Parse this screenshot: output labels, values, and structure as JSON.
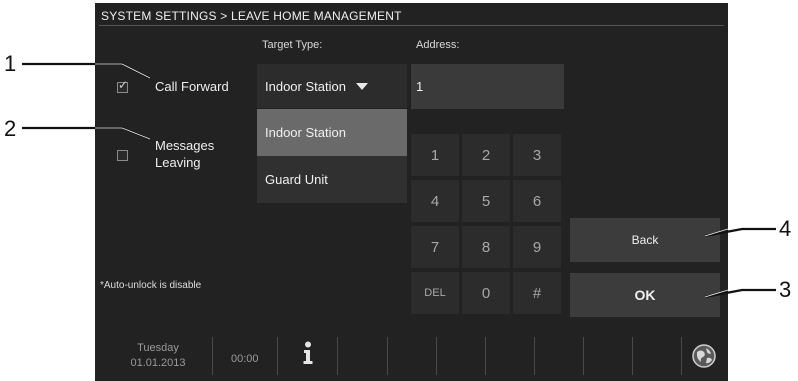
{
  "callouts": [
    "1",
    "2",
    "3",
    "4"
  ],
  "header": {
    "title": "SYSTEM SETTINGS > LEAVE HOME MANAGEMENT"
  },
  "columns": {
    "target_type": "Target Type:",
    "address": "Address:"
  },
  "options": {
    "call_forward": {
      "label": "Call Forward",
      "checked": true,
      "check_mark": "✓"
    },
    "messages_leaving": {
      "line1": "Messages",
      "line2": "Leaving",
      "checked": false
    }
  },
  "target_type": {
    "selected": "Indoor Station",
    "options": [
      "Indoor Station",
      "Guard Unit"
    ],
    "expanded": true
  },
  "address": {
    "value": "1"
  },
  "keypad": {
    "keys": [
      "1",
      "2",
      "3",
      "4",
      "5",
      "6",
      "7",
      "8",
      "9",
      "DEL",
      "0",
      "#"
    ]
  },
  "buttons": {
    "back": "Back",
    "ok": "OK"
  },
  "note": "*Auto-unlock is disable",
  "status_bar": {
    "day": "Tuesday",
    "date": "01.01.2013",
    "time": "00:00"
  },
  "colors": {
    "screen_bg": "#222222",
    "panel": "#2c2c2c",
    "highlight": "#6a6a6a",
    "button": "#3c3c3c"
  },
  "icons": [
    "info-icon",
    "globe-icon",
    "dropdown-caret-icon",
    "checkbox-tick-icon"
  ]
}
